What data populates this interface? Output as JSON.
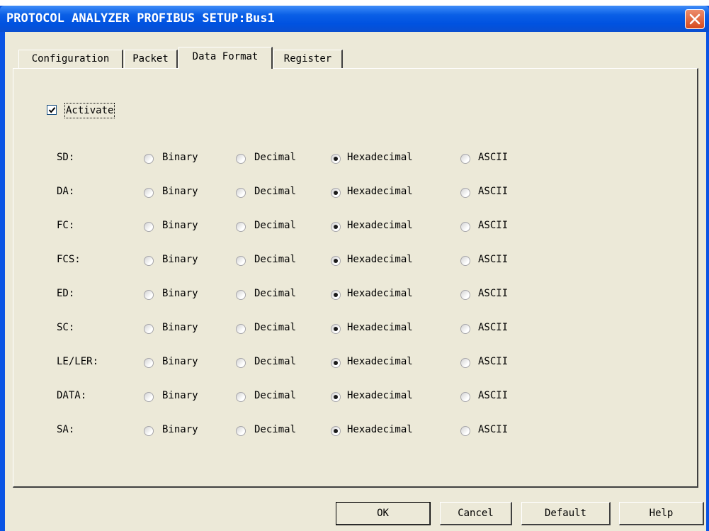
{
  "window": {
    "title": "PROTOCOL ANALYZER PROFIBUS SETUP:Bus1"
  },
  "tabs": [
    {
      "label": "Configuration",
      "active": false
    },
    {
      "label": "Packet",
      "active": false
    },
    {
      "label": "Data Format",
      "active": true
    },
    {
      "label": "Register",
      "active": false
    }
  ],
  "activate": {
    "label": "Activate",
    "checked": true
  },
  "format_options": [
    "Binary",
    "Decimal",
    "Hexadecimal",
    "ASCII"
  ],
  "rows": [
    {
      "label": "SD:",
      "selected": "Hexadecimal"
    },
    {
      "label": "DA:",
      "selected": "Hexadecimal"
    },
    {
      "label": "FC:",
      "selected": "Hexadecimal"
    },
    {
      "label": "FCS:",
      "selected": "Hexadecimal"
    },
    {
      "label": "ED:",
      "selected": "Hexadecimal"
    },
    {
      "label": "SC:",
      "selected": "Hexadecimal"
    },
    {
      "label": "LE/LER:",
      "selected": "Hexadecimal"
    },
    {
      "label": "DATA:",
      "selected": "Hexadecimal"
    },
    {
      "label": "SA:",
      "selected": "Hexadecimal"
    }
  ],
  "buttons": {
    "ok": "OK",
    "cancel": "Cancel",
    "default": "Default",
    "help": "Help"
  },
  "colors": {
    "titlebar": "#0052e0",
    "face": "#ece9d8",
    "close": "#d64a1f"
  },
  "icons": {
    "close": "close-icon",
    "check": "checkmark-icon"
  }
}
